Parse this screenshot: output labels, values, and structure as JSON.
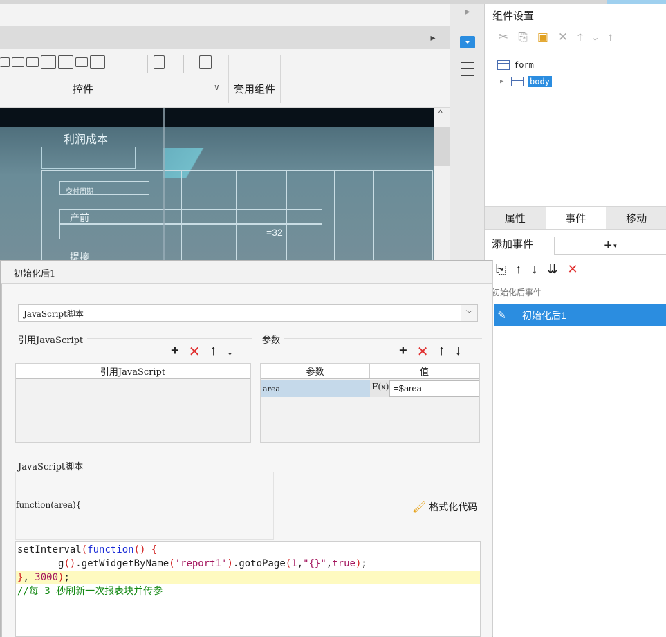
{
  "left_toolbar": {
    "group1_label": "控件",
    "group2_label": "套用组件"
  },
  "canvas": {
    "title": "利润成本",
    "small_label": "交付周期",
    "label_prenatal": "产前",
    "value_text": "=32",
    "label_partial": "提接"
  },
  "right_panel": {
    "title": "组件设置",
    "tree": [
      {
        "label": "form"
      },
      {
        "label": "body"
      }
    ],
    "tabs": [
      "属性",
      "事件",
      "移动"
    ],
    "add_event_label": "添加事件",
    "add_button": "+",
    "section_label": "初始化后事件",
    "selected_item": "初始化后1"
  },
  "dialog": {
    "title": "初始化后1",
    "script_type": "JavaScript脚本",
    "ref_group_title": "引用JavaScript",
    "ref_col_header": "引用JavaScript",
    "params_group_title": "参数",
    "params_col_header": "参数",
    "value_col_header": "值",
    "param_name": "area",
    "param_fx": "F(x)",
    "param_value": "=$area",
    "script_group_title": "JavaScript脚本",
    "function_header": "function(area){",
    "format_button": "格式化代码",
    "code_lines": [
      "setInterval(function() {",
      "      _g().getWidgetByName('report1').gotoPage(1,\"{}\",true);",
      "}, 3000);",
      "//每 3 秒刷新一次报表块并传参"
    ]
  }
}
